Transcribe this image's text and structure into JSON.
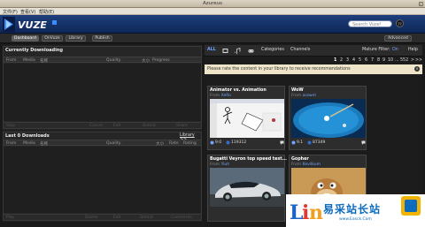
{
  "window": {
    "title": "Azureus"
  },
  "menu": {
    "file": "文件(F)",
    "view": "查看(V)",
    "help": "帮助(E)"
  },
  "header": {
    "search_placeholder": "Search Vuze!",
    "avatar_label": "??"
  },
  "nav": {
    "dashboard": "Dashboard",
    "onvuze": "OnVuze",
    "library": "Library",
    "publish": "Publish",
    "advanced": "Advanced"
  },
  "downloading": {
    "title": "Currently Downloading",
    "columns": [
      "From",
      "Media",
      "名称",
      "Quality",
      "大小",
      "Progress"
    ],
    "footer": [
      "Stop",
      "Cancel",
      "Edit",
      "Details",
      "Share"
    ]
  },
  "downloads": {
    "title": "Last 0 Downloads",
    "library_link": "Library >>",
    "columns": [
      "From",
      "Media",
      "名称",
      "Quality",
      "大小",
      "Rate",
      "Rating"
    ],
    "footer": [
      "Play",
      "Delete",
      "Edit",
      "Details",
      "Comments"
    ]
  },
  "browse": {
    "tabs": {
      "all": "ALL",
      "categories": "Categories",
      "channels": "Channels",
      "mature": "Mature Filter:",
      "mature_state": "On",
      "help": "Help"
    },
    "pager": {
      "pages": [
        "1",
        "2",
        "3",
        "4",
        "5",
        "6",
        "7",
        "8",
        "9",
        "10",
        "...",
        "552"
      ],
      "next": ">",
      "last": ">>",
      "current": "1"
    },
    "notice": "Please rate the content in your library to receive recommendations",
    "cards": [
      {
        "title": "Animator vs. Animation",
        "from_label": "From",
        "author": "XeRo",
        "rating": "9.0",
        "views": "119312"
      },
      {
        "title": "WoW",
        "from_label": "From",
        "author": "asswel",
        "rating": "9.1",
        "views": "87349"
      },
      {
        "title": "Bugatti Veyron top speed test...",
        "from_label": "From",
        "author": "Yiuh",
        "rating": "",
        "views": ""
      },
      {
        "title": "Gopher",
        "from_label": "From",
        "author": "Kevilkum",
        "rating": "",
        "views": ""
      }
    ]
  },
  "watermark": {
    "text": "易采站长站",
    "sub": "www.Easck.Com"
  },
  "colors": {
    "header_blue": "#1d3f7c",
    "link_blue": "#6fa4ff",
    "notice_bg": "#eee4c8"
  }
}
